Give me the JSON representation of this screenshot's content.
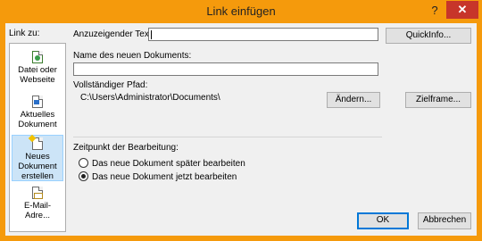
{
  "window": {
    "title": "Link einfügen",
    "help_label": "?",
    "close_label": "✕"
  },
  "sidebar": {
    "label": "Link zu:",
    "items": [
      {
        "label_lines": [
          "Datei oder",
          "Webseite"
        ],
        "icon": "web-page-icon",
        "selected": false
      },
      {
        "label_lines": [
          "Aktuelles",
          "Dokument"
        ],
        "icon": "current-document-icon",
        "selected": false
      },
      {
        "label_lines": [
          "Neues",
          "Dokument",
          "erstellen"
        ],
        "icon": "new-document-icon",
        "selected": true
      },
      {
        "label_lines": [
          "E-Mail-Adre..."
        ],
        "icon": "email-address-icon",
        "selected": false
      }
    ]
  },
  "form": {
    "display_text_label": "Anzuzeigender Text:",
    "display_text_value": "",
    "screentip_button": "QuickInfo...",
    "new_doc_name_label": "Name des neuen Dokuments:",
    "new_doc_name_value": "",
    "full_path_label": "Vollständiger Pfad:",
    "full_path_value": "C:\\Users\\Administrator\\Documents\\",
    "change_button": "Ändern...",
    "target_frame_button": "Zielframe...",
    "edit_time_label": "Zeitpunkt der Bearbeitung:",
    "edit_later_label": "Das neue Dokument später bearbeiten",
    "edit_now_label": "Das neue Dokument jetzt bearbeiten",
    "edit_now_selected": true
  },
  "footer": {
    "ok_label": "OK",
    "cancel_label": "Abbrechen"
  },
  "colors": {
    "accent_frame": "#f59a0c",
    "close_button": "#c7352a",
    "selection": "#cce4f7"
  }
}
